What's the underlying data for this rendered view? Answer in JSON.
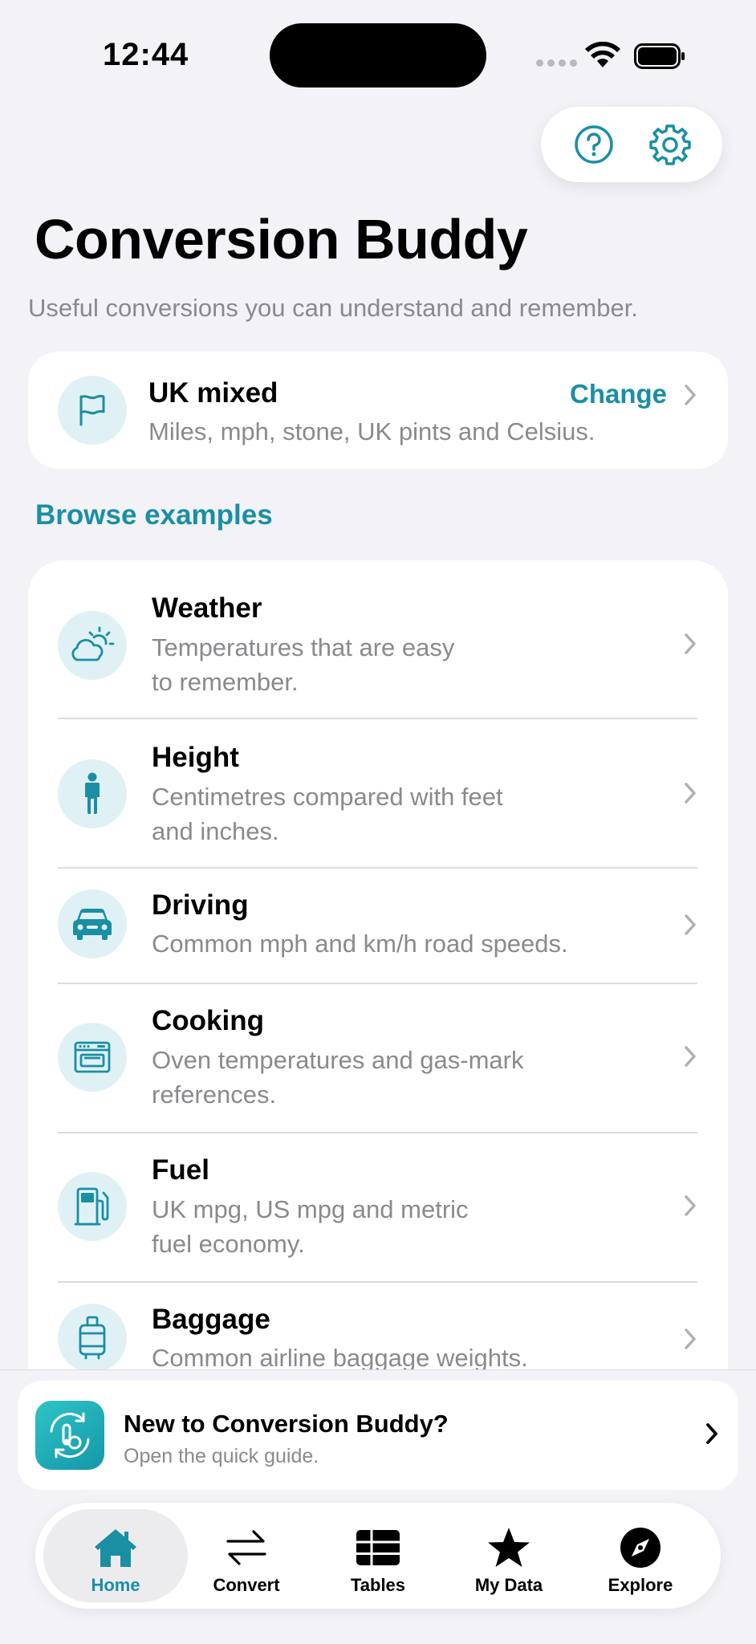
{
  "status": {
    "time": "12:44"
  },
  "header": {
    "title": "Conversion Buddy",
    "subtitle": "Useful conversions you can understand and remember."
  },
  "region": {
    "title": "UK mixed",
    "description": "Miles, mph, stone, UK pints and Celsius.",
    "change_label": "Change"
  },
  "browse": {
    "title": "Browse examples",
    "items": [
      {
        "title": "Weather",
        "desc1": "Temperatures that are easy",
        "desc2": "to remember.",
        "icon": "weather-icon"
      },
      {
        "title": "Height",
        "desc1": "Centimetres compared with feet",
        "desc2": "and inches.",
        "icon": "person-icon"
      },
      {
        "title": "Driving",
        "desc1": "Common mph and km/h road speeds.",
        "desc2": "",
        "icon": "car-icon"
      },
      {
        "title": "Cooking",
        "desc1": "Oven temperatures and gas-mark",
        "desc2": "references.",
        "icon": "oven-icon"
      },
      {
        "title": "Fuel",
        "desc1": "UK mpg, US mpg and metric",
        "desc2": "fuel economy.",
        "icon": "fuel-pump-icon"
      },
      {
        "title": "Baggage",
        "desc1": "Common airline baggage weights.",
        "desc2": "",
        "icon": "suitcase-icon"
      }
    ]
  },
  "guide": {
    "title": "New to Conversion Buddy?",
    "subtitle": "Open the quick guide."
  },
  "tabs": [
    {
      "label": "Home",
      "icon": "house-icon"
    },
    {
      "label": "Convert",
      "icon": "arrows-icon"
    },
    {
      "label": "Tables",
      "icon": "table-icon"
    },
    {
      "label": "My Data",
      "icon": "star-icon"
    },
    {
      "label": "Explore",
      "icon": "compass-icon"
    }
  ],
  "colors": {
    "accent": "#1a8fa3",
    "background": "#f2f2f7",
    "icon_bg": "#e0f1f5"
  }
}
